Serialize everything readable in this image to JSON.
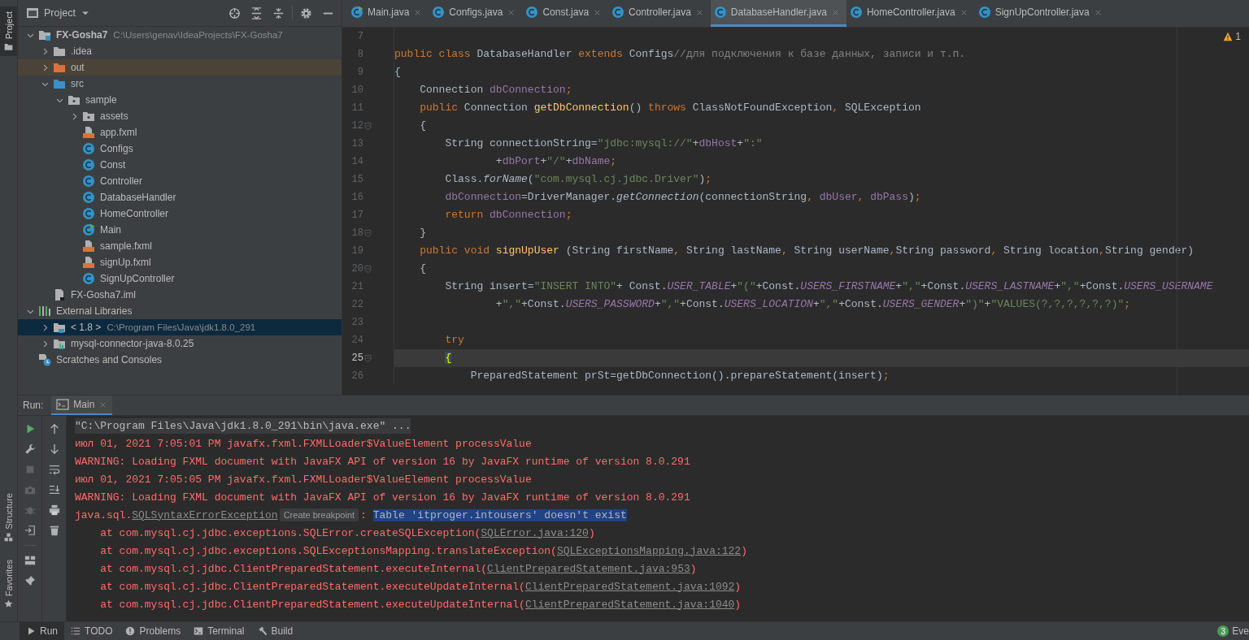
{
  "side_strip": {
    "top_tabs": [
      {
        "label": "Project",
        "selected": true
      }
    ],
    "bottom_tabs": [
      {
        "label": "Structure",
        "selected": false
      },
      {
        "label": "Favorites",
        "selected": false
      }
    ]
  },
  "project_panel": {
    "title": "Project",
    "tree": [
      {
        "label": "FX-Gosha7",
        "path": "C:\\Users\\genav\\IdeaProjects\\FX-Gosha7",
        "kind": "module",
        "expanded": true,
        "selected": false,
        "children": [
          {
            "label": ".idea",
            "kind": "folder",
            "expanded": false,
            "selected": false
          },
          {
            "label": "out",
            "kind": "excluded-folder",
            "expanded": false,
            "selected": false
          },
          {
            "label": "src",
            "kind": "source-folder",
            "expanded": true,
            "selected": false,
            "children": [
              {
                "label": "sample",
                "kind": "package",
                "expanded": true,
                "selected": false,
                "children": [
                  {
                    "label": "assets",
                    "kind": "package",
                    "expanded": false,
                    "selected": false
                  },
                  {
                    "label": "app.fxml",
                    "kind": "fxml",
                    "selected": false
                  },
                  {
                    "label": "Configs",
                    "kind": "class",
                    "selected": false
                  },
                  {
                    "label": "Const",
                    "kind": "class",
                    "selected": false
                  },
                  {
                    "label": "Controller",
                    "kind": "class",
                    "selected": false
                  },
                  {
                    "label": "DatabaseHandler",
                    "kind": "class",
                    "selected": false
                  },
                  {
                    "label": "HomeController",
                    "kind": "class",
                    "selected": false
                  },
                  {
                    "label": "Main",
                    "kind": "main-class",
                    "selected": false
                  },
                  {
                    "label": "sample.fxml",
                    "kind": "fxml",
                    "selected": false
                  },
                  {
                    "label": "signUp.fxml",
                    "kind": "fxml",
                    "selected": false
                  },
                  {
                    "label": "SignUpController",
                    "kind": "class",
                    "selected": false
                  }
                ]
              }
            ]
          },
          {
            "label": "FX-Gosha7.iml",
            "kind": "iml",
            "selected": false
          }
        ]
      },
      {
        "label": "External Libraries",
        "kind": "libraries",
        "expanded": true,
        "selected": false,
        "children": [
          {
            "label": "< 1.8 >",
            "path": "C:\\Program Files\\Java\\jdk1.8.0_291",
            "kind": "jdk",
            "expanded": false,
            "selected": true
          },
          {
            "label": "mysql-connector-java-8.0.25",
            "kind": "jar",
            "expanded": false,
            "selected": false
          }
        ]
      },
      {
        "label": "Scratches and Consoles",
        "kind": "scratches",
        "selected": false
      }
    ]
  },
  "editor": {
    "tabs": [
      {
        "label": "Main.java",
        "kind": "main-class",
        "selected": false
      },
      {
        "label": "Configs.java",
        "kind": "class",
        "selected": false
      },
      {
        "label": "Const.java",
        "kind": "class",
        "selected": false
      },
      {
        "label": "Controller.java",
        "kind": "class",
        "selected": false
      },
      {
        "label": "DatabaseHandler.java",
        "kind": "class",
        "selected": true
      },
      {
        "label": "HomeController.java",
        "kind": "class",
        "selected": false
      },
      {
        "label": "SignUpController.java",
        "kind": "class",
        "selected": false
      }
    ],
    "warnings": "1",
    "lines": [
      {
        "number": "7",
        "current": false,
        "fold": false
      },
      {
        "number": "8",
        "current": false,
        "fold": false,
        "tokens": [
          {
            "text": "public class ",
            "kind": "keyword"
          },
          {
            "text": "DatabaseHandler ",
            "kind": "plain"
          },
          {
            "text": "extends ",
            "kind": "keyword"
          },
          {
            "text": "Configs",
            "kind": "plain"
          },
          {
            "text": "//для подключения к базе данных, записи и т.п.",
            "kind": "comment"
          }
        ]
      },
      {
        "number": "9",
        "current": false,
        "fold": false,
        "tokens": [
          {
            "text": "{",
            "kind": "plain"
          }
        ]
      },
      {
        "number": "10",
        "current": false,
        "fold": false,
        "tokens": [
          {
            "text": "    Connection ",
            "kind": "plain"
          },
          {
            "text": "dbConnection",
            "kind": "field"
          },
          {
            "text": ";",
            "kind": "keyword"
          }
        ]
      },
      {
        "number": "11",
        "current": false,
        "fold": false,
        "tokens": [
          {
            "text": "    public ",
            "kind": "keyword"
          },
          {
            "text": "Connection ",
            "kind": "plain"
          },
          {
            "text": "getDbConnection",
            "kind": "method"
          },
          {
            "text": "() ",
            "kind": "plain"
          },
          {
            "text": "throws ",
            "kind": "keyword"
          },
          {
            "text": "ClassNotFoundException",
            "kind": "plain"
          },
          {
            "text": ", ",
            "kind": "keyword"
          },
          {
            "text": "SQLException",
            "kind": "plain"
          }
        ]
      },
      {
        "number": "12",
        "current": false,
        "fold": true,
        "tokens": [
          {
            "text": "    {",
            "kind": "plain"
          }
        ]
      },
      {
        "number": "13",
        "current": false,
        "fold": false,
        "tokens": [
          {
            "text": "        String connectionString=",
            "kind": "plain"
          },
          {
            "text": "\"jdbc:mysql://\"",
            "kind": "string"
          },
          {
            "text": "+",
            "kind": "plain"
          },
          {
            "text": "dbHost",
            "kind": "field"
          },
          {
            "text": "+",
            "kind": "plain"
          },
          {
            "text": "\":\"",
            "kind": "string"
          }
        ]
      },
      {
        "number": "14",
        "current": false,
        "fold": false,
        "tokens": [
          {
            "text": "                +",
            "kind": "plain"
          },
          {
            "text": "dbPort",
            "kind": "field"
          },
          {
            "text": "+",
            "kind": "plain"
          },
          {
            "text": "\"/\"",
            "kind": "string"
          },
          {
            "text": "+",
            "kind": "plain"
          },
          {
            "text": "dbName",
            "kind": "field"
          },
          {
            "text": ";",
            "kind": "keyword"
          }
        ]
      },
      {
        "number": "15",
        "current": false,
        "fold": false,
        "tokens": [
          {
            "text": "        Class.",
            "kind": "plain"
          },
          {
            "text": "forName",
            "kind": "static-method"
          },
          {
            "text": "(",
            "kind": "plain"
          },
          {
            "text": "\"com.mysql.cj.jdbc.Driver\"",
            "kind": "string"
          },
          {
            "text": ")",
            "kind": "plain"
          },
          {
            "text": ";",
            "kind": "keyword"
          }
        ]
      },
      {
        "number": "16",
        "current": false,
        "fold": false,
        "tokens": [
          {
            "text": "        dbConnection",
            "kind": "field"
          },
          {
            "text": "=DriverManager.",
            "kind": "plain"
          },
          {
            "text": "getConnection",
            "kind": "static-method"
          },
          {
            "text": "(connectionString",
            "kind": "plain"
          },
          {
            "text": ", ",
            "kind": "keyword"
          },
          {
            "text": "dbUser",
            "kind": "field"
          },
          {
            "text": ", ",
            "kind": "keyword"
          },
          {
            "text": "dbPass",
            "kind": "field"
          },
          {
            "text": ")",
            "kind": "plain"
          },
          {
            "text": ";",
            "kind": "keyword"
          }
        ]
      },
      {
        "number": "17",
        "current": false,
        "fold": false,
        "tokens": [
          {
            "text": "        return ",
            "kind": "keyword"
          },
          {
            "text": "dbConnection",
            "kind": "field"
          },
          {
            "text": ";",
            "kind": "keyword"
          }
        ]
      },
      {
        "number": "18",
        "current": false,
        "fold": true,
        "tokens": [
          {
            "text": "    }",
            "kind": "plain"
          }
        ]
      },
      {
        "number": "19",
        "current": false,
        "fold": false,
        "tokens": [
          {
            "text": "    public void ",
            "kind": "keyword"
          },
          {
            "text": "signUpUser ",
            "kind": "method"
          },
          {
            "text": "(String firstName",
            "kind": "plain"
          },
          {
            "text": ", ",
            "kind": "keyword"
          },
          {
            "text": "String lastName",
            "kind": "plain"
          },
          {
            "text": ", ",
            "kind": "keyword"
          },
          {
            "text": "String userName",
            "kind": "plain"
          },
          {
            "text": ",",
            "kind": "keyword"
          },
          {
            "text": "String password",
            "kind": "plain"
          },
          {
            "text": ", ",
            "kind": "keyword"
          },
          {
            "text": "String location",
            "kind": "plain"
          },
          {
            "text": ",",
            "kind": "keyword"
          },
          {
            "text": "String gender)",
            "kind": "plain"
          }
        ]
      },
      {
        "number": "20",
        "current": false,
        "fold": true,
        "tokens": [
          {
            "text": "    {",
            "kind": "plain"
          }
        ]
      },
      {
        "number": "21",
        "current": false,
        "fold": false,
        "tokens": [
          {
            "text": "        String insert=",
            "kind": "plain"
          },
          {
            "text": "\"INSERT INTO\"",
            "kind": "string"
          },
          {
            "text": "+ Const.",
            "kind": "plain"
          },
          {
            "text": "USER_TABLE",
            "kind": "constant"
          },
          {
            "text": "+",
            "kind": "plain"
          },
          {
            "text": "\"(\"",
            "kind": "string"
          },
          {
            "text": "+Const.",
            "kind": "plain"
          },
          {
            "text": "USERS_FIRSTNAME",
            "kind": "constant"
          },
          {
            "text": "+",
            "kind": "plain"
          },
          {
            "text": "\",\"",
            "kind": "string"
          },
          {
            "text": "+Const.",
            "kind": "plain"
          },
          {
            "text": "USERS_LASTNAME",
            "kind": "constant"
          },
          {
            "text": "+",
            "kind": "plain"
          },
          {
            "text": "\",\"",
            "kind": "string"
          },
          {
            "text": "+Const.",
            "kind": "plain"
          },
          {
            "text": "USERS_USERNAME",
            "kind": "constant"
          }
        ]
      },
      {
        "number": "22",
        "current": false,
        "fold": false,
        "tokens": [
          {
            "text": "                +",
            "kind": "plain"
          },
          {
            "text": "\",\"",
            "kind": "string"
          },
          {
            "text": "+Const.",
            "kind": "plain"
          },
          {
            "text": "USERS_PASSWORD",
            "kind": "constant"
          },
          {
            "text": "+",
            "kind": "plain"
          },
          {
            "text": "\",\"",
            "kind": "string"
          },
          {
            "text": "+Const.",
            "kind": "plain"
          },
          {
            "text": "USERS_LOCATION",
            "kind": "constant"
          },
          {
            "text": "+",
            "kind": "plain"
          },
          {
            "text": "\",\"",
            "kind": "string"
          },
          {
            "text": "+Const.",
            "kind": "plain"
          },
          {
            "text": "USERS_GENDER",
            "kind": "constant"
          },
          {
            "text": "+",
            "kind": "plain"
          },
          {
            "text": "\")\"",
            "kind": "string"
          },
          {
            "text": "+",
            "kind": "plain"
          },
          {
            "text": "\"VALUES(?,?,?,?,?,?)\"",
            "kind": "string"
          },
          {
            "text": ";",
            "kind": "keyword"
          }
        ]
      },
      {
        "number": "23",
        "current": false,
        "fold": false
      },
      {
        "number": "24",
        "current": false,
        "fold": false,
        "tokens": [
          {
            "text": "        try",
            "kind": "keyword"
          }
        ]
      },
      {
        "number": "25",
        "current": true,
        "fold": true,
        "tokens": [
          {
            "text": "        {",
            "kind": "brace-match"
          }
        ]
      },
      {
        "number": "26",
        "current": false,
        "fold": false,
        "tokens": [
          {
            "text": "            PreparedStatement prSt=getDbConnection().prepareStatement(insert)",
            "kind": "plain"
          },
          {
            "text": ";",
            "kind": "keyword"
          }
        ]
      }
    ]
  },
  "run_panel": {
    "label": "Run:",
    "tabs": [
      {
        "label": "Main",
        "selected": true
      }
    ],
    "console": [
      {
        "kind": "command",
        "tokens": [
          {
            "text": "\"C:\\Program Files\\Java\\jdk1.8.0_291\\bin\\java.exe\" ...",
            "kind": "plain"
          }
        ]
      },
      {
        "kind": "output",
        "tokens": [
          {
            "text": "июл 01, 2021 7:05:01 PM javafx.fxml.FXMLLoader$ValueElement processValue",
            "kind": "error"
          }
        ]
      },
      {
        "kind": "output",
        "tokens": [
          {
            "text": "WARNING: Loading FXML document with JavaFX API of version 16 by JavaFX runtime of version 8.0.291",
            "kind": "error"
          }
        ]
      },
      {
        "kind": "output",
        "tokens": [
          {
            "text": "июл 01, 2021 7:05:05 PM javafx.fxml.FXMLLoader$ValueElement processValue",
            "kind": "error"
          }
        ]
      },
      {
        "kind": "output",
        "tokens": [
          {
            "text": "WARNING: Loading FXML document with JavaFX API of version 16 by JavaFX runtime of version 8.0.291",
            "kind": "error"
          }
        ]
      },
      {
        "kind": "output",
        "tokens": [
          {
            "text": "java.sql.",
            "kind": "error"
          },
          {
            "text": "SQLSyntaxErrorException",
            "kind": "link"
          },
          {
            "text": "Create breakpoint",
            "kind": "hint"
          },
          {
            "text": ": ",
            "kind": "error"
          },
          {
            "text": "Table 'itproger.intousers' doesn't exist",
            "kind": "match"
          }
        ]
      },
      {
        "kind": "output",
        "tokens": [
          {
            "text": "    at com.mysql.cj.jdbc.exceptions.SQLError.createSQLException(",
            "kind": "error"
          },
          {
            "text": "SQLError.java:120",
            "kind": "link"
          },
          {
            "text": ")",
            "kind": "error"
          }
        ]
      },
      {
        "kind": "output",
        "tokens": [
          {
            "text": "    at com.mysql.cj.jdbc.exceptions.SQLExceptionsMapping.translateException(",
            "kind": "error"
          },
          {
            "text": "SQLExceptionsMapping.java:122",
            "kind": "link"
          },
          {
            "text": ")",
            "kind": "error"
          }
        ]
      },
      {
        "kind": "output",
        "tokens": [
          {
            "text": "    at com.mysql.cj.jdbc.ClientPreparedStatement.executeInternal(",
            "kind": "error"
          },
          {
            "text": "ClientPreparedStatement.java:953",
            "kind": "link"
          },
          {
            "text": ")",
            "kind": "error"
          }
        ]
      },
      {
        "kind": "output",
        "tokens": [
          {
            "text": "    at com.mysql.cj.jdbc.ClientPreparedStatement.executeUpdateInternal(",
            "kind": "error"
          },
          {
            "text": "ClientPreparedStatement.java:1092",
            "kind": "link"
          },
          {
            "text": ")",
            "kind": "error"
          }
        ]
      },
      {
        "kind": "output",
        "tokens": [
          {
            "text": "    at com.mysql.cj.jdbc.ClientPreparedStatement.executeUpdateInternal(",
            "kind": "error"
          },
          {
            "text": "ClientPreparedStatement.java:1040",
            "kind": "link"
          },
          {
            "text": ")",
            "kind": "error"
          }
        ]
      }
    ]
  },
  "tool_bar": {
    "items": [
      {
        "label": "Run",
        "kind": "run",
        "selected": true
      },
      {
        "label": "TODO",
        "kind": "todo",
        "selected": false
      },
      {
        "label": "Problems",
        "kind": "problems",
        "selected": false
      },
      {
        "label": "Terminal",
        "kind": "terminal",
        "selected": false
      },
      {
        "label": "Build",
        "kind": "build",
        "selected": false
      }
    ],
    "events_count": "3",
    "events_label": "Eve"
  }
}
